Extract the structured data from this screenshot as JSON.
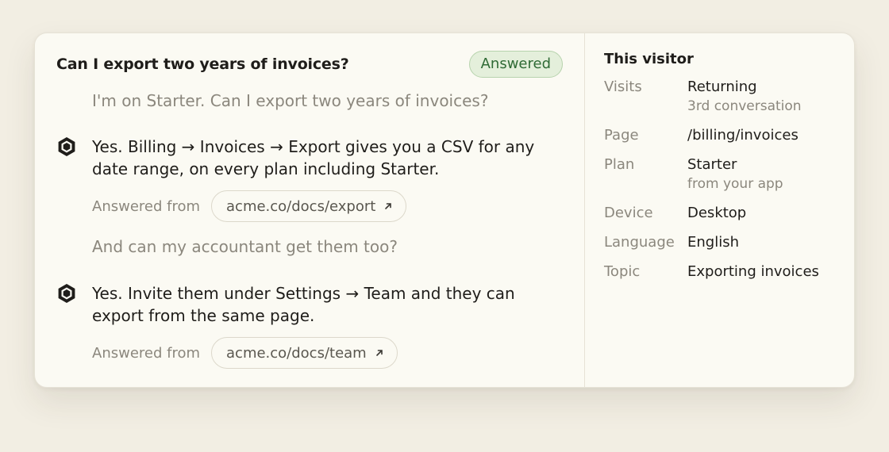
{
  "conversation": {
    "title": "Can I export two years of invoices?",
    "status": "Answered",
    "messages": [
      {
        "role": "user",
        "text": "I'm on Starter. Can I export two years of invoices?"
      },
      {
        "role": "bot",
        "text": "Yes. Billing → Invoices → Export gives you a CSV for any date range, on every plan including Starter.",
        "source_label": "Answered from",
        "source": "acme.co/docs/export"
      },
      {
        "role": "user",
        "text": "And can my accountant get them too?"
      },
      {
        "role": "bot",
        "text": "Yes. Invite them under Settings → Team and they can export from the same page.",
        "source_label": "Answered from",
        "source": "acme.co/docs/team"
      }
    ]
  },
  "visitor": {
    "title": "This visitor",
    "attributes": [
      {
        "key": "Visits",
        "value": "Returning",
        "sub": "3rd conversation"
      },
      {
        "key": "Page",
        "value": "/billing/invoices"
      },
      {
        "key": "Plan",
        "value": "Starter",
        "sub": "from your app"
      },
      {
        "key": "Device",
        "value": "Desktop"
      },
      {
        "key": "Language",
        "value": "English"
      },
      {
        "key": "Topic",
        "value": "Exporting invoices"
      }
    ]
  },
  "icons": {
    "bot": "hexagon-bot-icon",
    "external": "external-link-icon"
  },
  "colors": {
    "background": "#f2eee3",
    "card": "#fbfaf3",
    "answered_badge_bg": "#e4efdb",
    "answered_badge_text": "#2f6a35"
  }
}
